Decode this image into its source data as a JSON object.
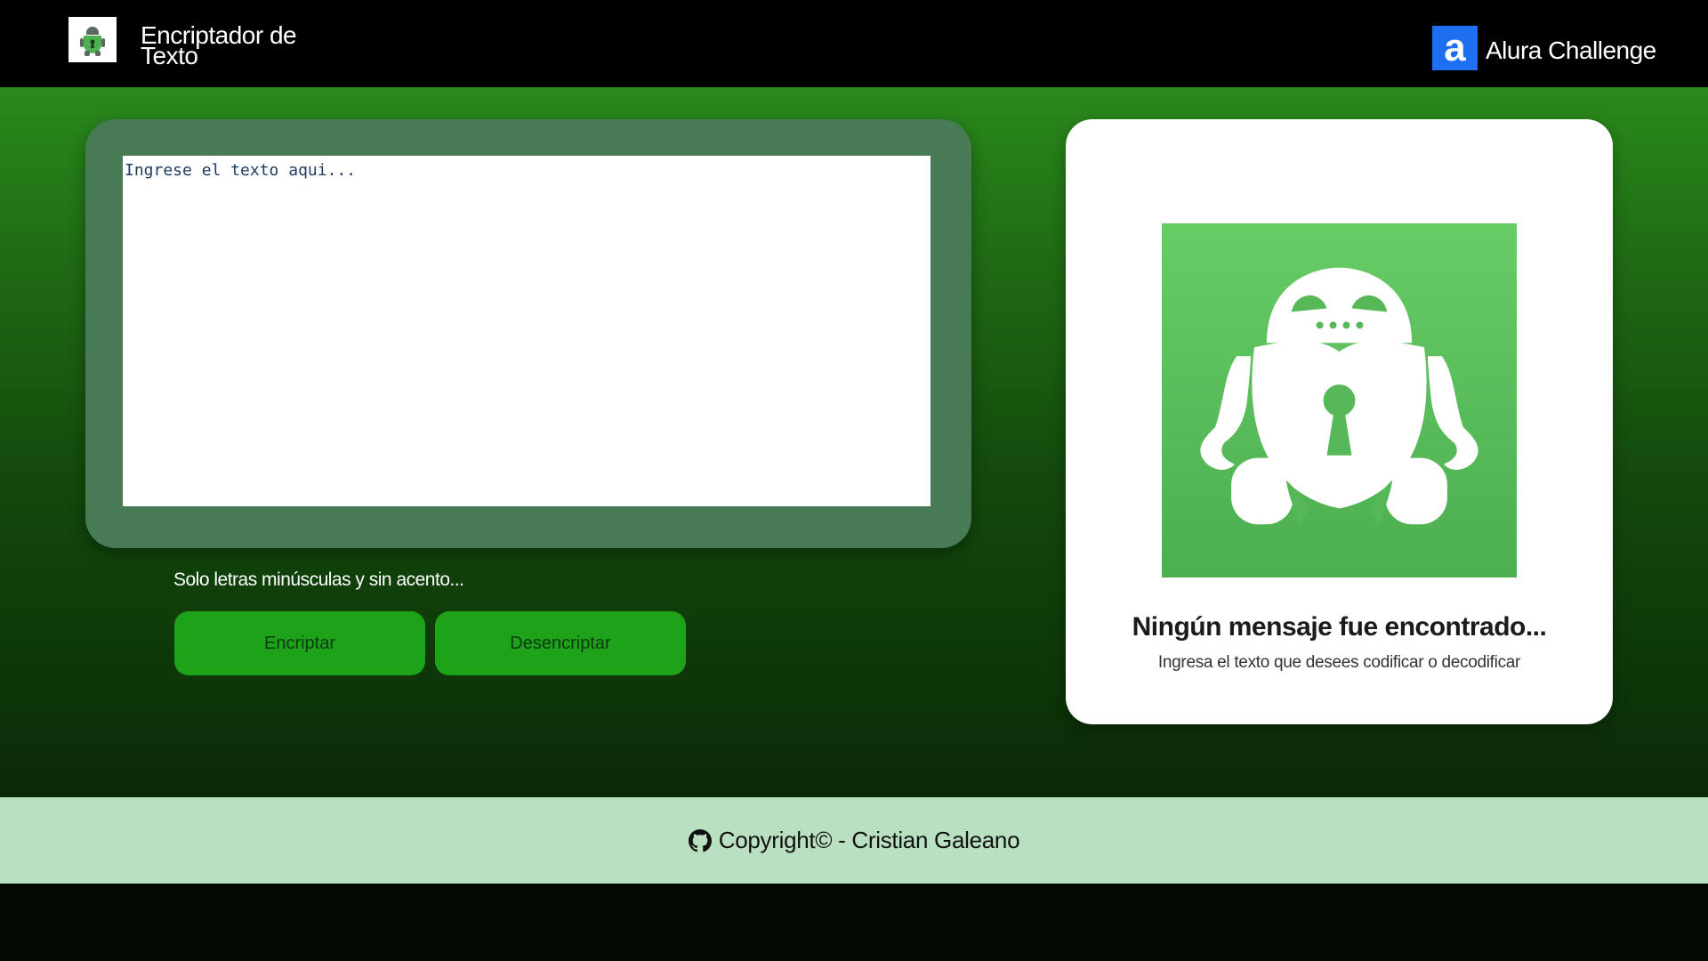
{
  "header": {
    "logo_icon": "robot-lock-icon",
    "title": "Encriptador de Texto",
    "brand_icon": "alura-a-icon",
    "brand_icon_glyph": "a",
    "brand_label": "Alura Challenge"
  },
  "input": {
    "placeholder": "Ingrese el texto aqui...",
    "value": "",
    "hint": "Solo letras minúsculas y sin acento..."
  },
  "actions": {
    "encrypt_label": "Encriptar",
    "decrypt_label": "Desencriptar"
  },
  "output": {
    "image_icon": "robot-lock-icon",
    "title": "Ningún mensaje fue encontrado...",
    "subtitle": "Ingresa el texto que desees codificar o decodificar"
  },
  "footer": {
    "icon": "github-icon",
    "text": "Copyright© - Cristian Galeano"
  },
  "colors": {
    "header_bg": "#000000",
    "main_gradient_top": "#2a8a1b",
    "main_gradient_bottom": "#0b2a07",
    "panel_bg": "#467b55",
    "button_bg": "#1ea21a",
    "brand_blue": "#1f6ff2",
    "robot_green": "#4caf50",
    "footer_bg": "#b9e0c1"
  }
}
